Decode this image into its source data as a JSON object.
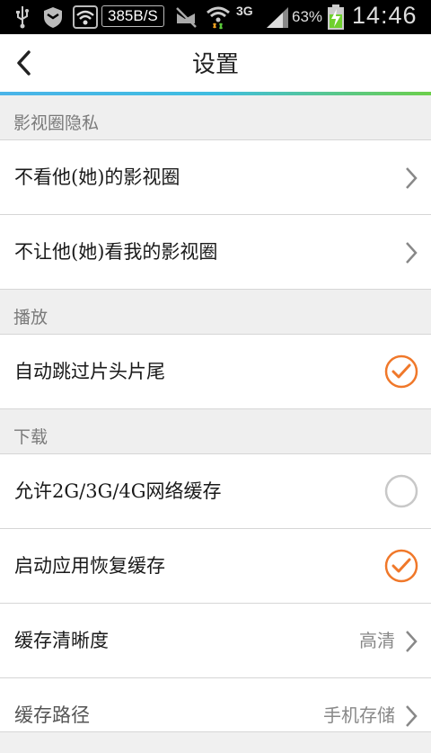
{
  "status_bar": {
    "network_speed": "385B/S",
    "network_type": "3G",
    "battery_percent": "63%",
    "time": "14:46"
  },
  "header": {
    "title": "设置"
  },
  "sections": [
    {
      "title": "影视圈隐私",
      "rows": [
        {
          "label": "不看他(她)的影视圈",
          "control": "chevron"
        },
        {
          "label": "不让他(她)看我的影视圈",
          "control": "chevron"
        }
      ]
    },
    {
      "title": "播放",
      "rows": [
        {
          "label": "自动跳过片头片尾",
          "control": "checkbox",
          "checked": true
        }
      ]
    },
    {
      "title": "下载",
      "rows": [
        {
          "label": "允许2G/3G/4G网络缓存",
          "control": "checkbox",
          "checked": false
        },
        {
          "label": "启动应用恢复缓存",
          "control": "checkbox",
          "checked": true
        },
        {
          "label": "缓存清晰度",
          "value": "高清",
          "control": "chevron"
        },
        {
          "label": "缓存路径",
          "value": "手机存储",
          "control": "chevron"
        }
      ]
    }
  ],
  "colors": {
    "accent_check": "#f0782a",
    "unchecked_circle": "#c8c8c8",
    "title_underline_start": "#4ab4e8",
    "title_underline_end": "#6ccf4a"
  }
}
